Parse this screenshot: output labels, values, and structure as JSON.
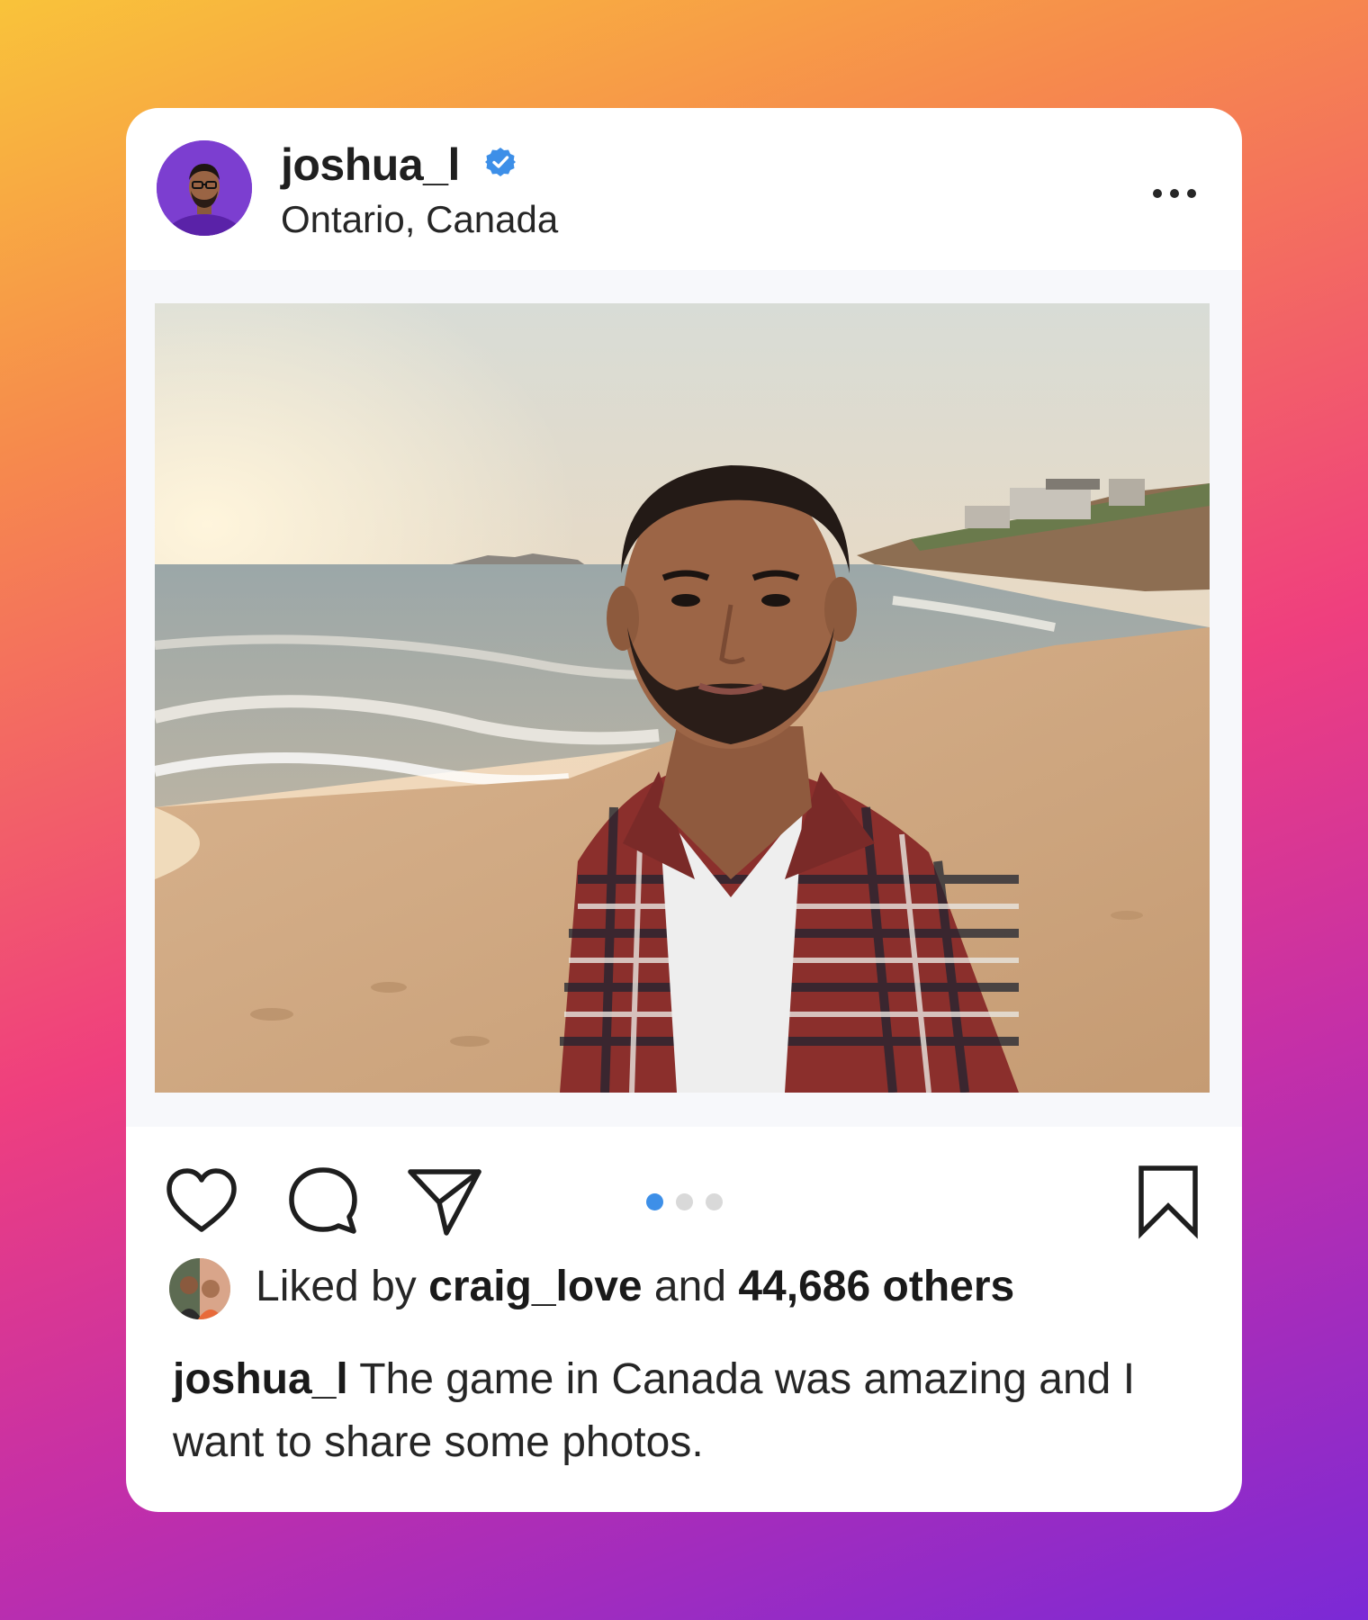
{
  "post": {
    "username": "joshua_l",
    "location": "Ontario, Canada",
    "verified": true,
    "carousel": {
      "total_slides": 3,
      "active_slide": 1
    },
    "likes": {
      "prefix": "Liked by ",
      "liker": "craig_love",
      "middle": " and ",
      "others": "44,686 others"
    },
    "caption": {
      "author": "joshua_l",
      "text": " The game in Canada was amazing and I want to share some photos."
    }
  },
  "icons": {
    "more": "more-horizontal-icon",
    "like": "heart-icon",
    "comment": "comment-bubble-icon",
    "share": "paper-plane-icon",
    "save": "bookmark-icon",
    "verified": "verified-badge-icon"
  },
  "colors": {
    "verified_blue": "#3d8fe8",
    "active_dot": "#3d8fe8",
    "inactive_dot": "#d9d9d9",
    "card_bg": "#ffffff"
  }
}
